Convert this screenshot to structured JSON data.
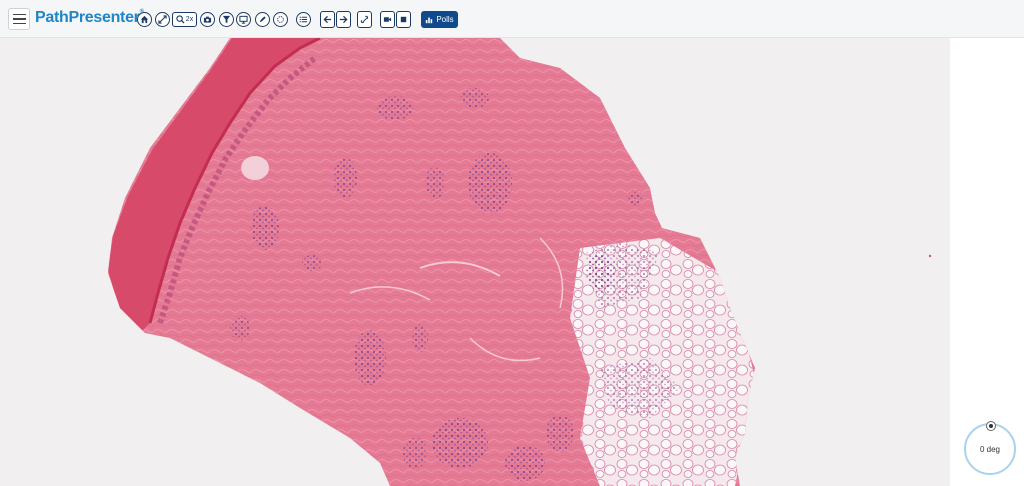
{
  "app": {
    "logo_text": "PathPresenter",
    "logo_mark": "®"
  },
  "toolbar": {
    "zoom_label": "2x",
    "polls_label": "Polls",
    "buttons": [
      {
        "icon": "home-icon"
      },
      {
        "icon": "fullscreen-icon"
      },
      {
        "icon": "zoom-icon"
      },
      {
        "icon": "camera-icon"
      },
      {
        "icon": "filter-icon"
      },
      {
        "icon": "monitor-icon"
      },
      {
        "icon": "pen-icon"
      },
      {
        "icon": "circle-icon"
      },
      {
        "icon": "list-icon"
      },
      {
        "icon": "arrow-left-icon"
      },
      {
        "icon": "arrow-right-icon"
      },
      {
        "icon": "link-icon"
      },
      {
        "icon": "video-icon"
      },
      {
        "icon": "stop-icon"
      }
    ]
  },
  "viewer": {
    "background_color": "#f1efef",
    "tissue_color": "#e57a95",
    "epidermis_color": "#d84a6a",
    "nuclei_color": "#8a4d8c"
  },
  "rotation": {
    "label": "0 deg"
  }
}
